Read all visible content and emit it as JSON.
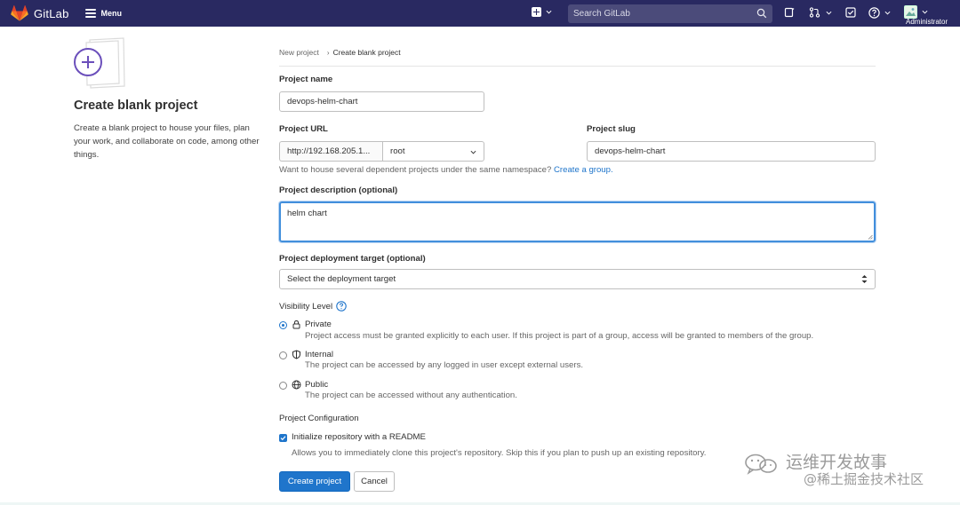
{
  "navbar": {
    "brand": "GitLab",
    "menu_label": "Menu",
    "search_placeholder": "Search GitLab",
    "user_label": "Administrator",
    "bg_color": "#292961"
  },
  "intro": {
    "title": "Create blank project",
    "text": "Create a blank project to house your files, plan your work, and collaborate on code, among other things."
  },
  "breadcrumb": {
    "parent": "New project",
    "current": "Create blank project"
  },
  "form": {
    "project_name_label": "Project name",
    "project_name_value": "devops-helm-chart",
    "project_url_label": "Project URL",
    "project_url_prefix": "http://192.168.205.1...",
    "namespace_value": "root",
    "project_slug_label": "Project slug",
    "project_slug_value": "devops-helm-chart",
    "namespace_help": "Want to house several dependent projects under the same namespace?",
    "create_group_link": "Create a group.",
    "description_label": "Project description (optional)",
    "description_value": "helm chart",
    "deployment_label": "Project deployment target (optional)",
    "deployment_value": "Select the deployment target",
    "visibility_label": "Visibility Level",
    "visibility": {
      "private_title": "Private",
      "private_desc": "Project access must be granted explicitly to each user. If this project is part of a group, access will be granted to members of the group.",
      "internal_title": "Internal",
      "internal_desc": "The project can be accessed by any logged in user except external users.",
      "public_title": "Public",
      "public_desc": "The project can be accessed without any authentication.",
      "selected": "Private"
    },
    "config_label": "Project Configuration",
    "readme_label": "Initialize repository with a README",
    "readme_desc": "Allows you to immediately clone this project's repository. Skip this if you plan to push up an existing repository.",
    "readme_checked": true
  },
  "actions": {
    "create": "Create project",
    "cancel": "Cancel"
  },
  "watermark": {
    "line1": "运维开发故事",
    "line2": "@稀土掘金技术社区"
  },
  "colors": {
    "primary": "#1f75cb",
    "focus": "#428fdc",
    "navbar": "#292961"
  }
}
